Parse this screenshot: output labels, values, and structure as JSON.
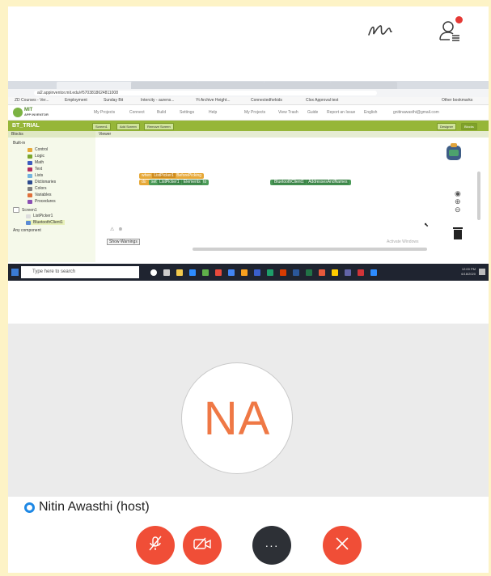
{
  "toolbar": {
    "annotate_icon": "squiggle-pen-icon",
    "participants_icon": "participants-icon",
    "has_notification": true
  },
  "shared_screen": {
    "browser": {
      "url": "ai2.appinventor.mit.edu/#5703818624811008",
      "bookmarks": [
        "ZD Courses - Ver...",
        "Employment",
        "Sunday Bit",
        "Intercity - aurens...",
        "Yt Archive Height...",
        "Connectedforkids",
        "Clox Approval test",
        "Other bookmarks"
      ]
    },
    "app_inventor": {
      "logo_line1": "MIT",
      "logo_line2": "APP INVENTOR",
      "menu": [
        "My Projects",
        "Connect",
        "Build",
        "Settings",
        "Help",
        "My Projects",
        "View Trash",
        "Guide",
        "Report an Issue",
        "English",
        "gnitinawasthi@gmail.com"
      ],
      "project_name": "BT_TRIAL",
      "buttons": [
        "Screen1",
        "Add Screen",
        "Remove Screen"
      ],
      "right_buttons": [
        "Designer",
        "Blocks"
      ],
      "blocks_header": "Blocks",
      "viewer_header": "Viewer",
      "tree": [
        "Built-in",
        "Control",
        "Logic",
        "Math",
        "Text",
        "Lists",
        "Dictionaries",
        "Colors",
        "Variables",
        "Procedures",
        "Screen1",
        "ListPicker1",
        "BluetoothClient1",
        "Any component"
      ],
      "code_blocks": {
        "when": "when",
        "event_component": "ListPicker1",
        "event": "BeforePicking",
        "do": "do",
        "set": "set",
        "set_component": "ListPicker1",
        "property": "Elements",
        "to": "to",
        "value_component": "BluetoothClient1",
        "value_property": "AddressesAndNames"
      },
      "show_warnings": "Show Warnings",
      "watermark": "Activate Windows"
    },
    "taskbar": {
      "search_placeholder": "Type here to search",
      "time": "12:00 PM",
      "date": "6/18/2020"
    }
  },
  "participant": {
    "initials": "NA",
    "name": "Nitin Awasthi (host)",
    "avatar_text_color": "#ef7845"
  },
  "controls": {
    "mute_icon": "mic-off-icon",
    "video_icon": "video-off-icon",
    "more_icon": "more-icon",
    "leave_icon": "close-icon",
    "accent": "#f04e37"
  }
}
